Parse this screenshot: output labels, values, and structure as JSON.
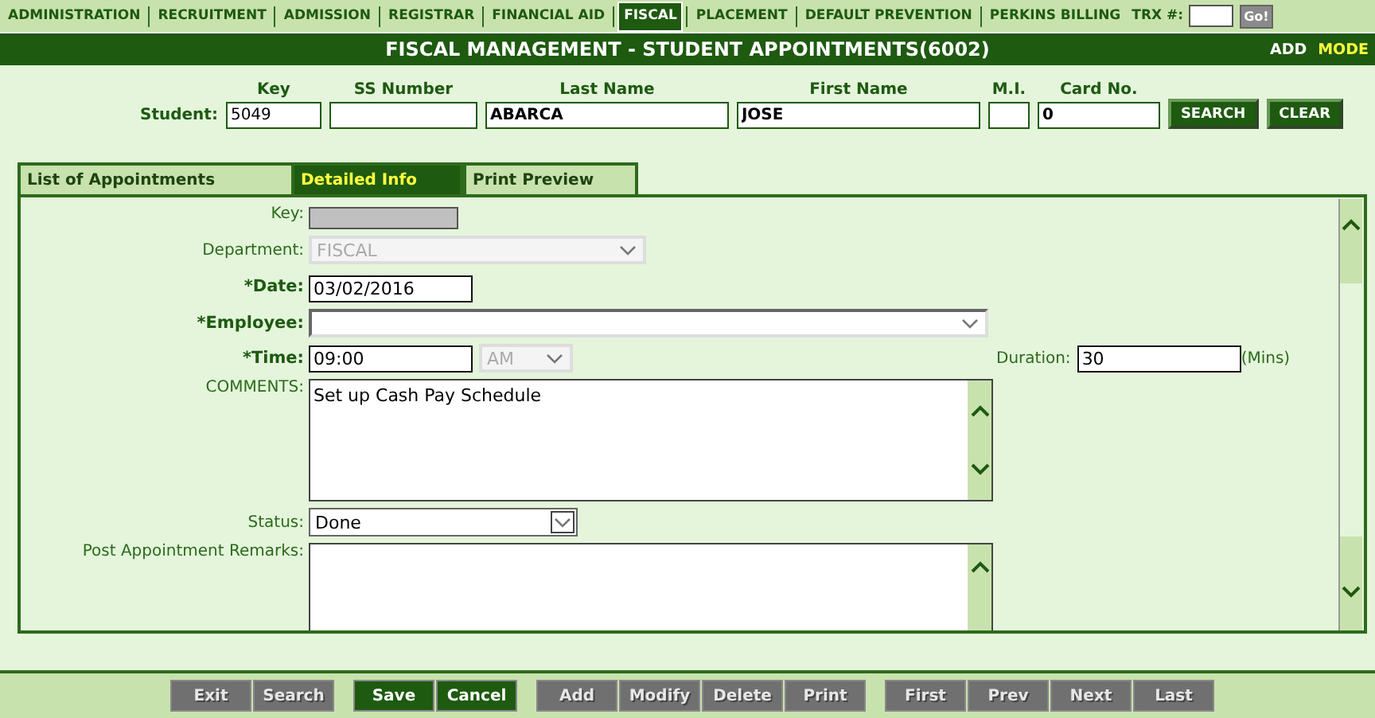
{
  "nav": {
    "items": [
      {
        "label": "ADMINISTRATION",
        "selected": false
      },
      {
        "label": "RECRUITMENT",
        "selected": false
      },
      {
        "label": "ADMISSION",
        "selected": false
      },
      {
        "label": "REGISTRAR",
        "selected": false
      },
      {
        "label": "FINANCIAL AID",
        "selected": false
      },
      {
        "label": "FISCAL",
        "selected": true
      },
      {
        "label": "PLACEMENT",
        "selected": false
      },
      {
        "label": "DEFAULT PREVENTION",
        "selected": false
      },
      {
        "label": "PERKINS BILLING",
        "selected": false
      }
    ],
    "trx_label": "TRX #:",
    "go_button": "Go!"
  },
  "header": {
    "title": "FISCAL MANAGEMENT - STUDENT APPOINTMENTS(6002)",
    "mode_action": "ADD",
    "mode_label": "MODE"
  },
  "student": {
    "label": "Student:",
    "fields": [
      {
        "heading": "Key",
        "value": "5049",
        "bold": false
      },
      {
        "heading": "SS Number"
      },
      {
        "heading": "Last Name",
        "value": "ABARCA",
        "bold": true
      },
      {
        "heading": "First Name",
        "value": "JOSE",
        "bold": true
      },
      {
        "heading": "M.I."
      },
      {
        "heading": "Card No.",
        "value": "0",
        "bold": true
      }
    ],
    "buttons": [
      "SEARCH",
      "CLEAR"
    ]
  },
  "tabs": [
    {
      "label": "List of Appointments",
      "selected": false
    },
    {
      "label": "Detailed Info",
      "selected": true
    },
    {
      "label": "Print Preview",
      "selected": false
    }
  ],
  "form": {
    "key": {
      "label": "Key:",
      "disabled": true
    },
    "department": {
      "label": "Department:",
      "value": "FISCAL",
      "disabled": true
    },
    "date": {
      "label": "*Date:",
      "value": "03/02/2016",
      "required": true
    },
    "employee": {
      "label": "*Employee:",
      "required": true
    },
    "time": {
      "label": "*Time:",
      "value": "09:00",
      "required": true,
      "meridiem": {
        "value": "AM",
        "disabled": true
      }
    },
    "duration": {
      "label": "Duration:",
      "value": "30",
      "unit": "(Mins)"
    },
    "comments": {
      "label": "COMMENTS:",
      "value": "Set up Cash Pay Schedule"
    },
    "status": {
      "label": "Status:",
      "value": "Done"
    },
    "remarks": {
      "label": "Post Appointment Remarks:"
    }
  },
  "toolbar": [
    [
      {
        "label": "Exit",
        "disabled": true
      },
      {
        "label": "Search",
        "disabled": true
      }
    ],
    [
      {
        "label": "Save",
        "disabled": false
      },
      {
        "label": "Cancel",
        "disabled": false
      }
    ],
    [
      {
        "label": "Add",
        "disabled": true
      },
      {
        "label": "Modify",
        "disabled": true
      },
      {
        "label": "Delete",
        "disabled": true
      },
      {
        "label": "Print",
        "disabled": true
      }
    ],
    [
      {
        "label": "First",
        "disabled": true
      },
      {
        "label": "Prev",
        "disabled": true
      },
      {
        "label": "Next",
        "disabled": true
      },
      {
        "label": "Last",
        "disabled": true
      }
    ]
  ]
}
